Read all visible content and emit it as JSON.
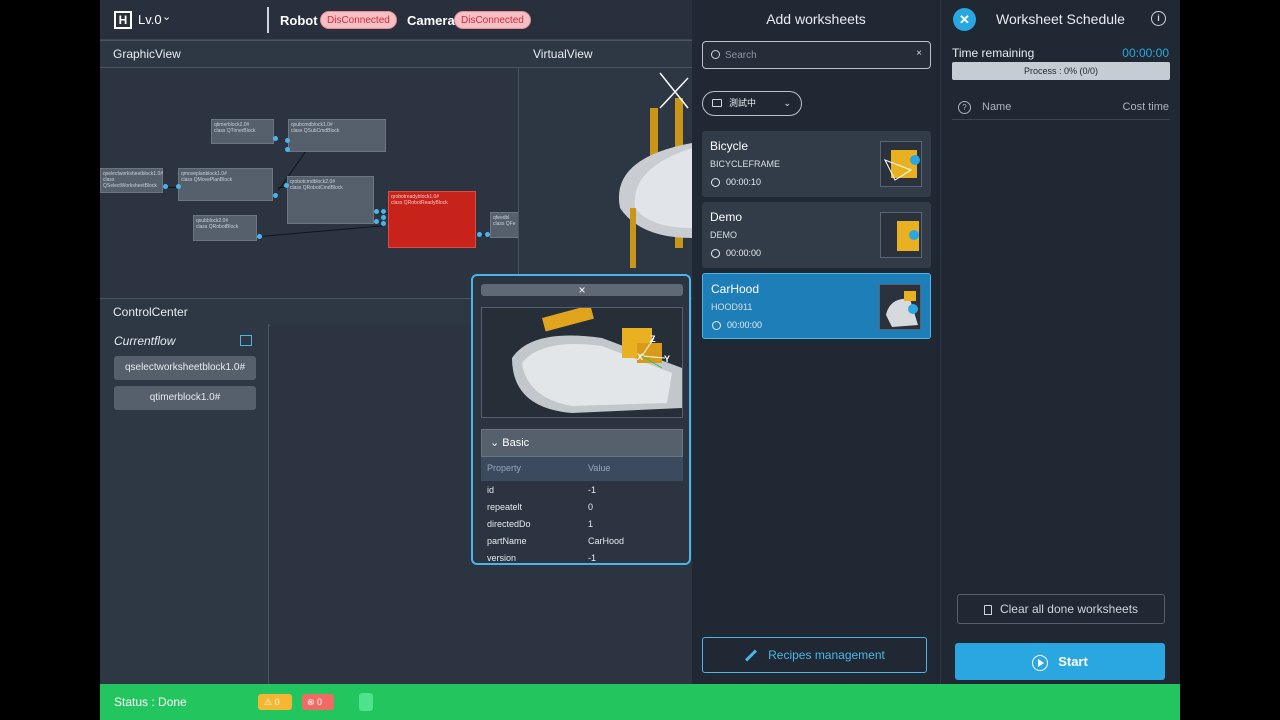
{
  "topbar": {
    "level": "Lv.0",
    "robot_label": "Robot",
    "robot_status": "DisConnected",
    "camera_label": "Camera",
    "camera_status": "DisConnected"
  },
  "graphic_view": {
    "title": "GraphicView",
    "nodes": [
      {
        "label": "qtimerblock2.0#",
        "sub": "class QTimerBlock"
      },
      {
        "label": "qsubcmdblock1.0#",
        "sub": "class QSubCmdBlock"
      },
      {
        "label": "qmoveplanblock1.0#",
        "sub": "class QMovePlanBlock"
      },
      {
        "label": "qselectworksheetblock1.0#",
        "sub": "class QSelectWorksheetBlock"
      },
      {
        "label": "qrobotcmdblock2.0#",
        "sub": "class QRobotCmdBlock"
      },
      {
        "label": "qsubblock2.0#",
        "sub": "class QRobotBlock"
      },
      {
        "label": "qrobotreadyblock1.0#",
        "sub": "class QRobotReadyBlock"
      },
      {
        "label": "qfeedbl",
        "sub": "class QFe"
      }
    ]
  },
  "virtual_view": {
    "title": "VirtualView"
  },
  "control_center": {
    "title": "ControlCenter",
    "currentflow_label": "Currentflow",
    "flow_items": [
      "qselectworksheetblock1.0#",
      "qtimerblock1.0#"
    ]
  },
  "popup": {
    "close_glyph": "×",
    "section_label": "Basic",
    "columns": [
      "Property",
      "Value"
    ],
    "rows": [
      {
        "property": "id",
        "value": "-1"
      },
      {
        "property": "repeatelt",
        "value": "0"
      },
      {
        "property": "directedDo",
        "value": "1"
      },
      {
        "property": "partName",
        "value": "CarHood"
      },
      {
        "property": "version",
        "value": "-1"
      }
    ],
    "axes": {
      "x": "X",
      "y": "Y",
      "z": "Z"
    }
  },
  "add_worksheets": {
    "title": "Add worksheets",
    "search_placeholder": "Search",
    "clear_glyph": "×",
    "folder": "測試中",
    "cards": [
      {
        "name": "Bicycle",
        "code": "BICYCLEFRAME",
        "time": "00:00:10",
        "selected": false
      },
      {
        "name": "Demo",
        "code": "DEMO",
        "time": "00:00:00",
        "selected": false
      },
      {
        "name": "CarHood",
        "code": "HOOD911",
        "time": "00:00:00",
        "selected": true
      }
    ],
    "recipes_label": "Recipes management"
  },
  "schedule": {
    "title": "Worksheet Schedule",
    "time_remaining_label": "Time remaining",
    "time_remaining_value": "00:00:00",
    "progress_text": "Process : 0% (0/0)",
    "progress_fraction": 0,
    "col_name": "Name",
    "col_cost": "Cost time",
    "clear_label": "Clear all done worksheets",
    "start_label": "Start"
  },
  "statusbar": {
    "status_text": "Status : Done",
    "warnings": "0",
    "errors": "0"
  },
  "colors": {
    "accent": "#2aa7e0",
    "status_green": "#22c55e",
    "disconnected_red": "#d42a3a",
    "node_red": "#c8231b"
  }
}
